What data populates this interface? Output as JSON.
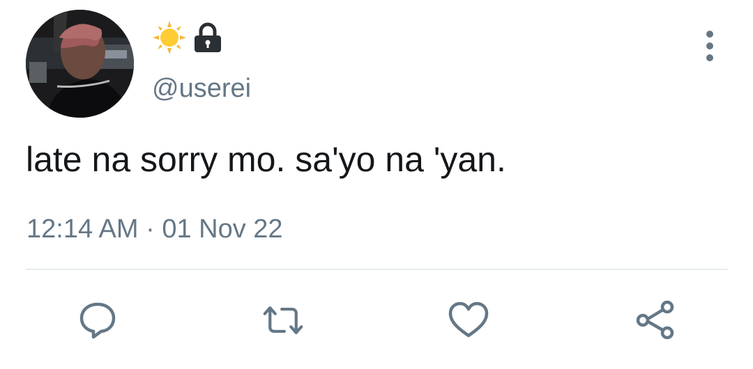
{
  "tweet": {
    "display_name_icons": [
      "sun-icon",
      "lock-icon"
    ],
    "handle": "@userei",
    "text": "late na sorry mo. sa'yo na 'yan.",
    "time": "12:14 AM",
    "separator": "·",
    "date": "01 Nov 22"
  },
  "actions": [
    "reply-icon",
    "retweet-icon",
    "like-icon",
    "share-icon"
  ],
  "colors": {
    "text": "#14171a",
    "secondary": "#657786",
    "divider": "#e6ecf0",
    "sun": "#ffcc33",
    "lock": "#292f33"
  }
}
